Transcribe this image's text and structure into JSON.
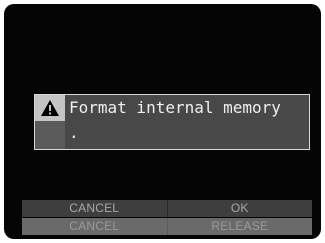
{
  "dialog": {
    "icon": "warning-triangle-icon",
    "message_line1": "Format internal memory",
    "message_line2": "."
  },
  "buttons": {
    "top": {
      "left_label": "CANCEL",
      "right_label": "OK"
    },
    "bottom": {
      "left_label": "CANCEL",
      "right_label": "RELEASE"
    }
  },
  "colors": {
    "screen_bg": "#050505",
    "dialog_bg": "#484848",
    "dialog_border": "#d8d8d8",
    "text": "#efefef"
  }
}
